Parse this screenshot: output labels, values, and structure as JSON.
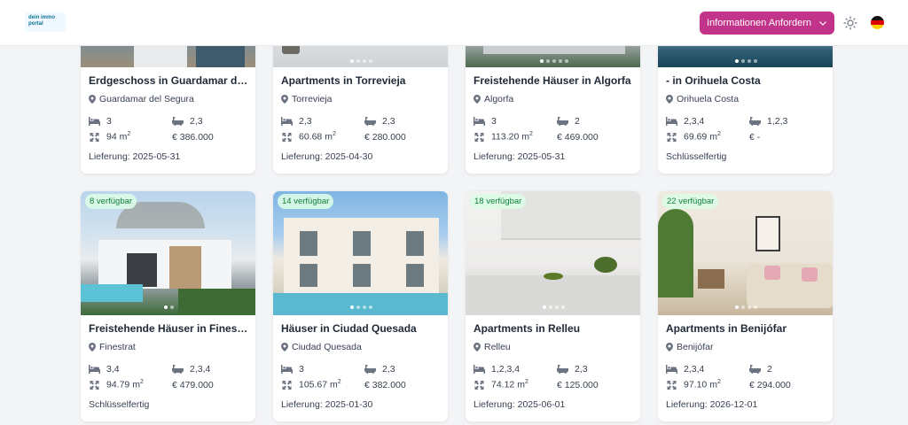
{
  "header": {
    "logo_line1": "dein immo",
    "logo_line2": "portal",
    "cta_label": "Informationen Anfordern",
    "cta_color": "#c2348a"
  },
  "listings": [
    {
      "title": "Erdgeschoss in Guardamar del Segura",
      "location": "Guardamar del Segura",
      "beds": "3",
      "baths": "2,3",
      "area": "94 m",
      "price": "€  386.000",
      "footer": "Lieferung: 2025-05-31",
      "badge": "",
      "dots": 0
    },
    {
      "title": "Apartments in Torrevieja",
      "location": "Torrevieja",
      "beds": "2,3",
      "baths": "2,3",
      "area": "60.68 m",
      "price": "€  280.000",
      "footer": "Lieferung: 2025-04-30",
      "badge": "",
      "dots": 4
    },
    {
      "title": "Freistehende Häuser in Algorfa",
      "location": "Algorfa",
      "beds": "3",
      "baths": "2",
      "area": "113.20 m",
      "price": "€  469.000",
      "footer": "Lieferung: 2025-05-31",
      "badge": "",
      "dots": 5
    },
    {
      "title": "- in Orihuela Costa",
      "location": "Orihuela Costa",
      "beds": "2,3,4",
      "baths": "1,2,3",
      "area": "69.69 m",
      "price": "€  -",
      "footer": "Schlüsselfertig",
      "badge": "",
      "dots": 4
    },
    {
      "title": "Freistehende Häuser in Finestrat",
      "location": "Finestrat",
      "beds": "3,4",
      "baths": "2,3,4",
      "area": "94.79 m",
      "price": "€  479.000",
      "footer": "Schlüsselfertig",
      "badge": "8 verfügbar",
      "dots": 2
    },
    {
      "title": "Häuser in Ciudad Quesada",
      "location": "Ciudad Quesada",
      "beds": "3",
      "baths": "2,3",
      "area": "105.67 m",
      "price": "€  382.000",
      "footer": "Lieferung: 2025-01-30",
      "badge": "14 verfügbar",
      "dots": 4
    },
    {
      "title": "Apartments in Relleu",
      "location": "Relleu",
      "beds": "1,2,3,4",
      "baths": "2,3",
      "area": "74.12 m",
      "price": "€  125.000",
      "footer": "Lieferung: 2025-06-01",
      "badge": "18 verfügbar",
      "dots": 4
    },
    {
      "title": "Apartments in Benijófar",
      "location": "Benijófar",
      "beds": "2,3,4",
      "baths": "2",
      "area": "97.10 m",
      "price": "€  294.000",
      "footer": "Lieferung: 2026-12-01",
      "badge": "22 verfügbar",
      "dots": 4
    }
  ],
  "area_sup": "2",
  "icons": {
    "location": "map-pin-icon",
    "beds": "bed-icon",
    "baths": "bathtub-icon",
    "area": "expand-arrows-icon",
    "theme": "sun-icon",
    "language": "german-flag-icon"
  }
}
